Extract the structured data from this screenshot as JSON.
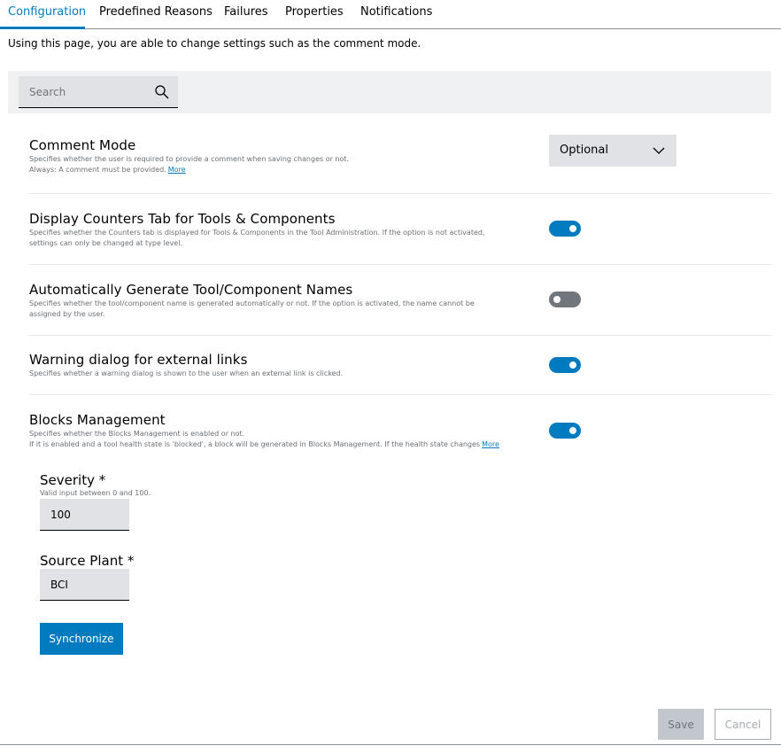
{
  "tabs": [
    {
      "label": "Configuration",
      "active": true
    },
    {
      "label": "Predefined Reasons",
      "active": false
    },
    {
      "label": "Failures",
      "active": false
    },
    {
      "label": "Properties",
      "active": false
    },
    {
      "label": "Notifications",
      "active": false
    }
  ],
  "intro": "Using this page, you are able to change settings such as the comment mode.",
  "search": {
    "placeholder": "Search",
    "icon": "search-icon"
  },
  "settings": {
    "comment_mode": {
      "title": "Comment Mode",
      "desc_line1": "Specifies whether the user is required to provide a comment when saving changes or not.",
      "desc_line2": "Always: A comment must be provided.",
      "more": "More",
      "selected": "Optional"
    },
    "counters_tab": {
      "title": "Display Counters Tab for Tools & Components",
      "desc_line1": "Specifies whether the Counters tab is displayed for Tools & Components in the Tool Administration. If the option is not activated,",
      "desc_line2": "settings can only be changed at type level.",
      "enabled": true
    },
    "auto_names": {
      "title": "Automatically Generate Tool/Component Names",
      "desc_line1": "Specifies whether the tool/component name is generated automatically or not. If the option is activated, the name cannot be",
      "desc_line2": "assigned by the user.",
      "enabled": false
    },
    "warning_dialog": {
      "title": "Warning dialog for external links",
      "desc_line1": "Specifies whether a warning dialog is shown to the user when an external link is clicked.",
      "enabled": true
    },
    "blocks_management": {
      "title": "Blocks Management",
      "desc_line1": "Specifies whether the Blocks Management is enabled or not.",
      "desc_line2": "If it is enabled and a tool health state is 'blocked', a block will be generated in Blocks Management. If the health state changes",
      "more": "More",
      "enabled": true
    }
  },
  "severity": {
    "label": "Severity *",
    "hint": "Valid input between 0 and 100.",
    "value": "100"
  },
  "source_plant": {
    "label": "Source Plant *",
    "value": "BCI"
  },
  "buttons": {
    "synchronize": "Synchronize",
    "save": "Save",
    "cancel": "Cancel"
  },
  "colors": {
    "accent": "#007bc0",
    "toggle_off": "#71767c",
    "field_bg": "#e0e2e5"
  }
}
